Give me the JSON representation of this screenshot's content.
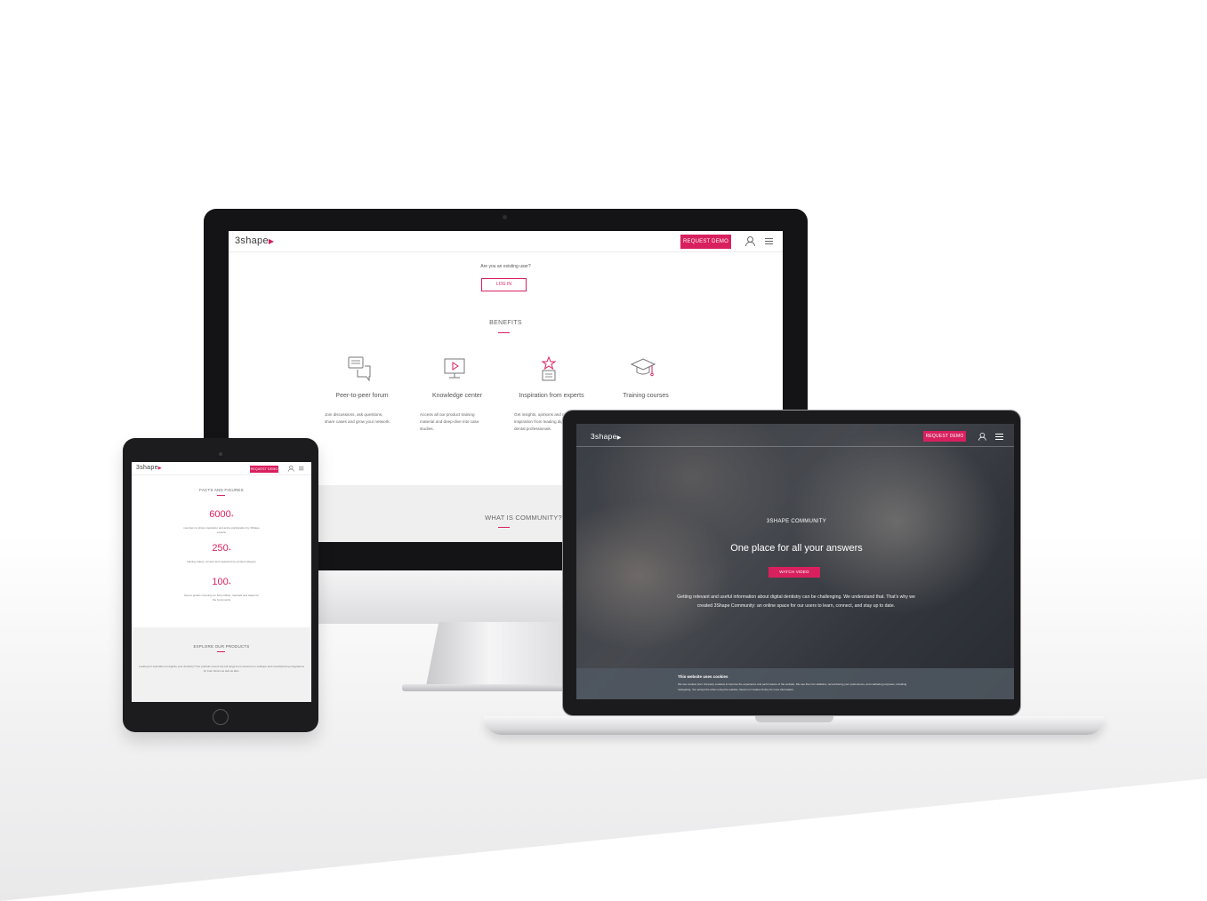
{
  "brand": {
    "logo_text": "3shape",
    "logo_mark": "▶",
    "accent_color": "#d9205f"
  },
  "desktop": {
    "nav": {
      "request_demo": "REQUEST DEMO",
      "user_icon": "user-icon",
      "menu_icon": "menu-icon"
    },
    "existing_user_prompt": "Are you an existing user?",
    "login_button": "LOG IN",
    "benefits_heading": "BENEFITS",
    "benefits": [
      {
        "icon": "chat-bubbles-icon",
        "title": "Peer-to-peer forum",
        "text": "Join discussions, ask questions, share cases and grow your network."
      },
      {
        "icon": "video-player-icon",
        "title": "Knowledge center",
        "text": "Access all our product training material and deep-dive into case studies."
      },
      {
        "icon": "star-book-icon",
        "title": "Inspiration from experts",
        "text": "Get insights, opinions and new inspiration from leading digital dental professionals."
      },
      {
        "icon": "graduation-cap-icon",
        "title": "Training courses",
        "text": ""
      }
    ],
    "community_heading": "WHAT IS COMMUNITY?"
  },
  "tablet": {
    "nav": {
      "request_demo": "REQUEST DEMO"
    },
    "facts_heading": "FACTS AND FIGURES",
    "facts": [
      {
        "number": "6000",
        "suffix": "+",
        "text": "members to share inspiration and active participation by 3Shape experts"
      },
      {
        "number": "250",
        "suffix": "+",
        "text": "training videos, content and organized by product category"
      },
      {
        "number": "100",
        "suffix": "+",
        "text": "how-to guides covering our full portfolio, manuals and cases for the Community"
      }
    ],
    "explore_heading": "EXPLORE OUR PRODUCTS",
    "explore_text": "Looking for inspiration to digitize your dentistry? Our portfolio covers the full range from scanners to software and manufacturing integrations for both clinics as well as labs."
  },
  "laptop": {
    "nav": {
      "request_demo": "REQUEST DEMO"
    },
    "eyebrow": "3SHAPE COMMUNITY",
    "title": "One place for all your answers",
    "watch_video": "WATCH VIDEO",
    "body": "Getting relevant and useful information about digital dentistry can be challenging. We understand that. That's why we created 3Shape Community: an online space for our users to learn, connect, and stay up to date.",
    "cookie_title": "This website uses cookies",
    "cookie_text": "We use cookies (incl. 3rd party cookies) to improve the experience and performance of the website. We use them for statistics, remembering your preferences, and marketing purposes, including retargeting. You accept the when using the website. Read our Cookies Policy for more information."
  }
}
